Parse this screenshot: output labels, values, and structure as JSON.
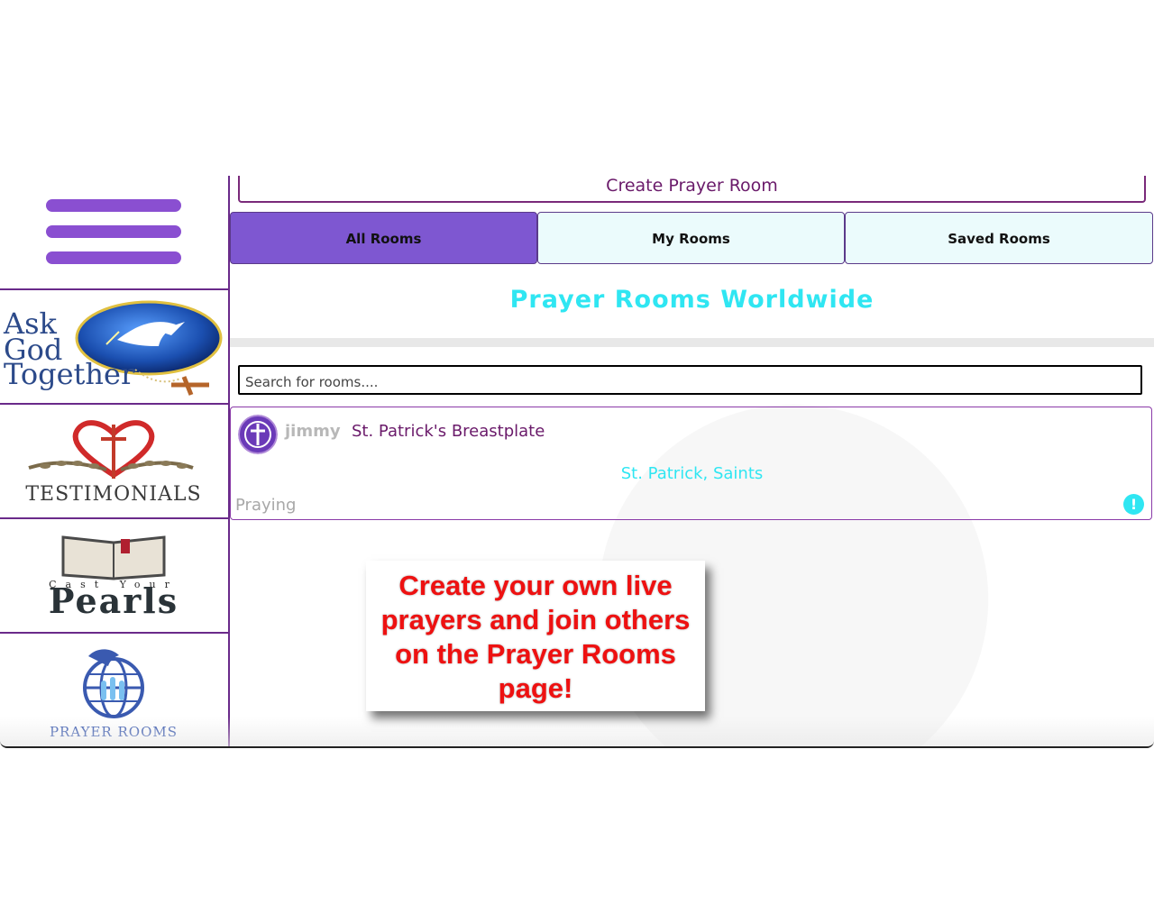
{
  "header": {
    "create_button_label": "Create Prayer Room"
  },
  "tabs": [
    {
      "label": "All Rooms",
      "active": true
    },
    {
      "label": "My Rooms",
      "active": false
    },
    {
      "label": "Saved Rooms",
      "active": false
    }
  ],
  "main": {
    "title": "Prayer Rooms Worldwide",
    "search_placeholder": "Search for rooms...."
  },
  "rooms": [
    {
      "owner": "jimmy",
      "name": "St. Patrick's Breastplate",
      "tags": "St. Patrick, Saints",
      "status": "Praying",
      "alert_icon": "exclamation-icon"
    }
  ],
  "sidebar": {
    "menu_icon": "hamburger-menu-icon",
    "items": [
      {
        "name": "ask-god-together",
        "logo_text": [
          "Ask",
          "God",
          "Together"
        ]
      },
      {
        "name": "testimonials",
        "logo_text": "TESTIMONIALS"
      },
      {
        "name": "cast-your-pearls",
        "logo_text_top": "Cast Your",
        "logo_text_main": "Pearls"
      },
      {
        "name": "prayer-rooms",
        "logo_text": "PRAYER ROOMS"
      }
    ]
  },
  "callout": {
    "text": "Create your own live prayers and join others on the Prayer Rooms page!"
  },
  "colors": {
    "accent": "#7e57d1",
    "cyan": "#2fe6f2",
    "plum": "#6a1a6a",
    "callout_red": "#ee1111"
  }
}
